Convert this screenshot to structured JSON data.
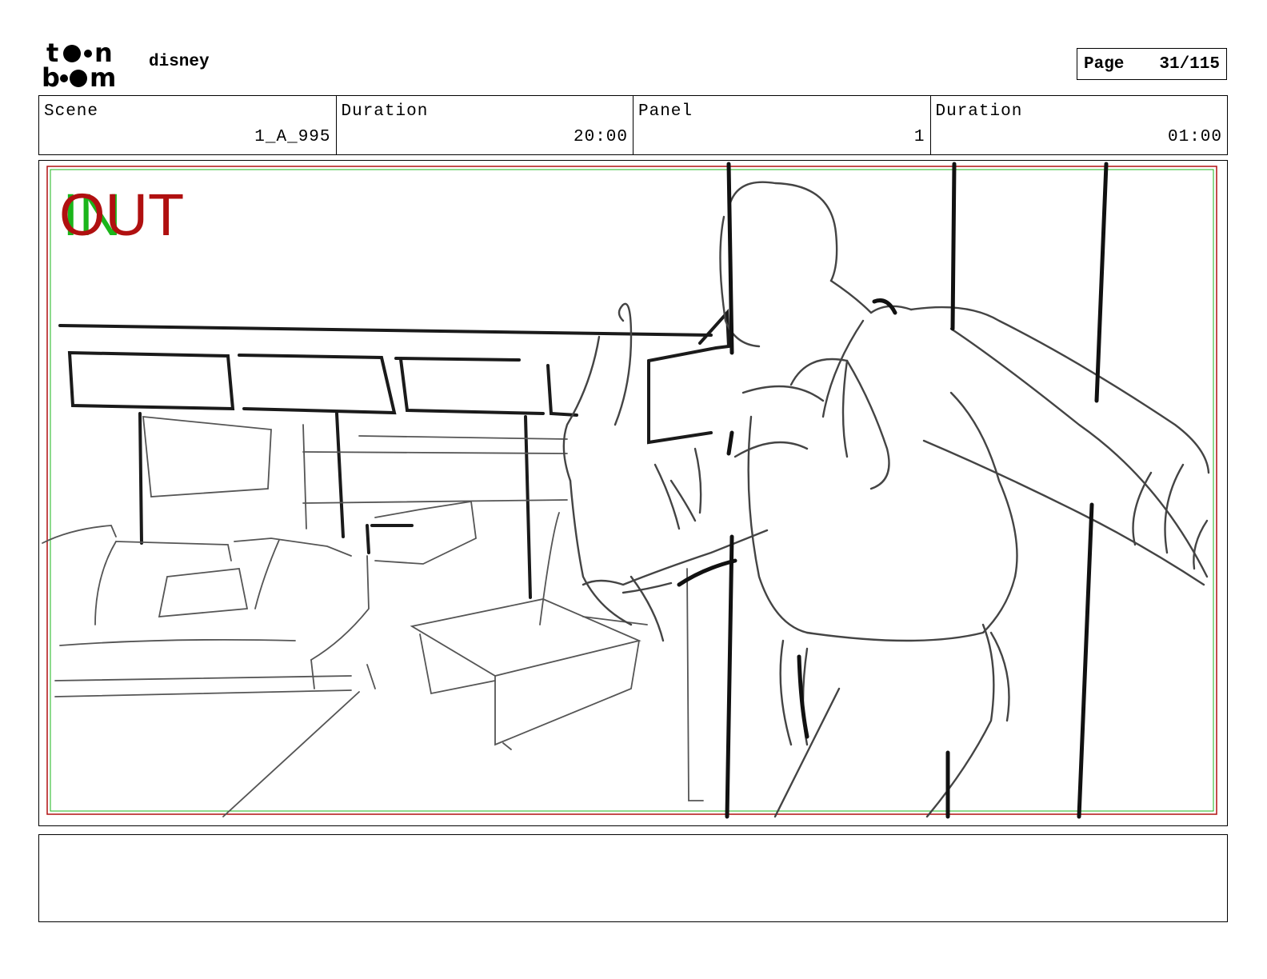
{
  "header": {
    "logo_icon": "toon-boom-logo",
    "project": "disney",
    "page_label": "Page",
    "page_value": "31/115"
  },
  "info": {
    "scene_label": "Scene",
    "scene_value": "1_A_995",
    "scene_duration_label": "Duration",
    "scene_duration_value": "20:00",
    "panel_label": "Panel",
    "panel_value": "1",
    "panel_duration_label": "Duration",
    "panel_duration_value": "01:00"
  },
  "panel": {
    "marker_in": "IN",
    "marker_out": "OUT",
    "marker_in_color": "#1bb51b",
    "marker_out_color": "#b01010",
    "safe_frame_color": "#b01010",
    "action_frame_color": "#1bb51b"
  },
  "notes": {
    "text": ""
  }
}
